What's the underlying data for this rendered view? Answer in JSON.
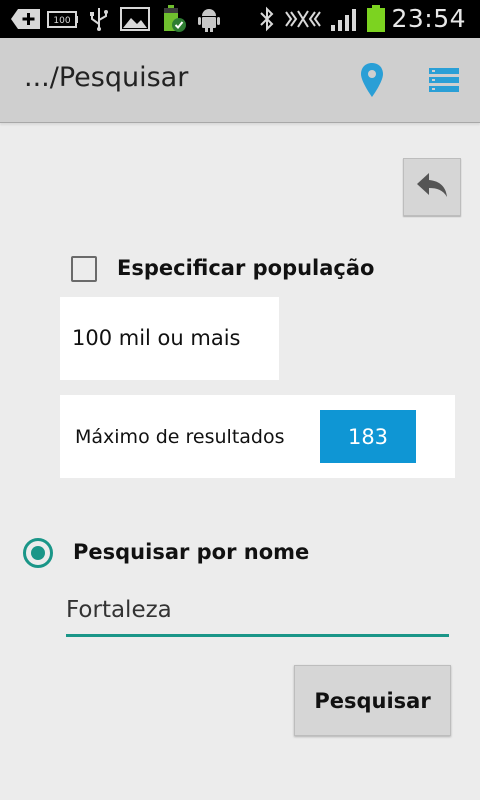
{
  "status_bar": {
    "time": "23:54",
    "icons": [
      "add-icon",
      "battery-100-icon",
      "usb-icon",
      "image-icon",
      "battery-check-icon",
      "android-icon",
      "bluetooth-icon",
      "vibrate-icon",
      "signal-icon",
      "battery-icon"
    ]
  },
  "action_bar": {
    "title": ".../Pesquisar",
    "location_icon": "location-pin-icon",
    "menu_icon": "list-menu-icon",
    "accent_color": "#2a9fd6"
  },
  "form": {
    "back_icon": "reply-arrow-icon",
    "population_checkbox_label": "Especificar população",
    "population_checked": false,
    "population_value": "100 mil ou mais",
    "max_results_label": "Máximo de resultados",
    "max_results_value": "183",
    "name_radio_label": "Pesquisar por nome",
    "name_radio_selected": true,
    "name_value": "Fortaleza",
    "search_button_label": "Pesquisar",
    "colors": {
      "teal": "#1a9688",
      "blue_value": "#0f96d4"
    }
  }
}
